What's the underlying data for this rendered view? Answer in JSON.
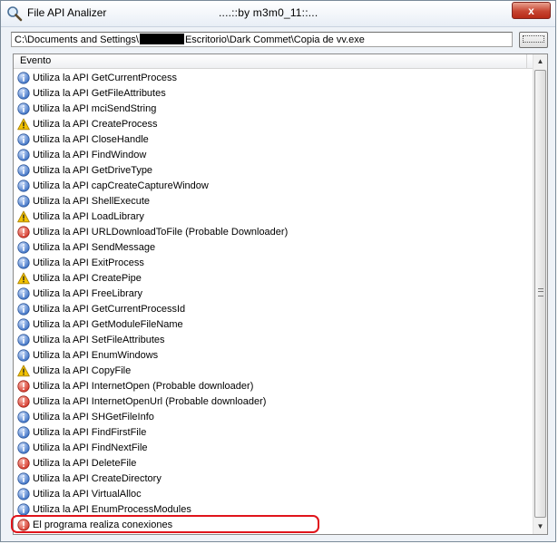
{
  "window": {
    "title": "File API Analizer",
    "title_extra": "....::by m3m0_11::...",
    "close_label": "x"
  },
  "file": {
    "path_before": "C:\\Documents and Settings\\",
    "path_after": "Escritorio\\Dark Commet\\Copia de vv.exe",
    "browse_label": "..."
  },
  "list": {
    "column_header": "Evento",
    "rows": [
      {
        "icon": "info",
        "text": "Utiliza la API GetCurrentProcess"
      },
      {
        "icon": "info",
        "text": "Utiliza la API GetFileAttributes"
      },
      {
        "icon": "info",
        "text": "Utiliza la API mciSendString"
      },
      {
        "icon": "warning",
        "text": "Utiliza la API CreateProcess"
      },
      {
        "icon": "info",
        "text": "Utiliza la API CloseHandle"
      },
      {
        "icon": "info",
        "text": "Utiliza la API FindWindow"
      },
      {
        "icon": "info",
        "text": "Utiliza la API GetDriveType"
      },
      {
        "icon": "info",
        "text": "Utiliza la API capCreateCaptureWindow"
      },
      {
        "icon": "info",
        "text": "Utiliza la API ShellExecute"
      },
      {
        "icon": "warning",
        "text": "Utiliza la API LoadLibrary"
      },
      {
        "icon": "error",
        "text": "Utiliza la API URLDownloadToFile (Probable Downloader)"
      },
      {
        "icon": "info",
        "text": "Utiliza la API SendMessage"
      },
      {
        "icon": "info",
        "text": "Utiliza la API ExitProcess"
      },
      {
        "icon": "warning",
        "text": "Utiliza la API CreatePipe"
      },
      {
        "icon": "info",
        "text": "Utiliza la API FreeLibrary"
      },
      {
        "icon": "info",
        "text": "Utiliza la API GetCurrentProcessId"
      },
      {
        "icon": "info",
        "text": "Utiliza la API GetModuleFileName"
      },
      {
        "icon": "info",
        "text": "Utiliza la API SetFileAttributes"
      },
      {
        "icon": "info",
        "text": "Utiliza la API EnumWindows"
      },
      {
        "icon": "warning",
        "text": "Utiliza la API CopyFile"
      },
      {
        "icon": "error",
        "text": "Utiliza la API InternetOpen (Probable downloader)"
      },
      {
        "icon": "error",
        "text": "Utiliza la API InternetOpenUrl (Probable downloader)"
      },
      {
        "icon": "info",
        "text": "Utiliza la API SHGetFileInfo"
      },
      {
        "icon": "info",
        "text": "Utiliza la API FindFirstFile"
      },
      {
        "icon": "info",
        "text": "Utiliza la API FindNextFile"
      },
      {
        "icon": "error",
        "text": "Utiliza la API DeleteFile"
      },
      {
        "icon": "info",
        "text": "Utiliza la API CreateDirectory"
      },
      {
        "icon": "info",
        "text": "Utiliza la API VirtualAlloc"
      },
      {
        "icon": "info",
        "text": "Utiliza la API EnumProcessModules"
      },
      {
        "icon": "error",
        "text": "El programa realiza conexiones"
      }
    ]
  },
  "colors": {
    "info": "#3a6fc4",
    "warning": "#f2c200",
    "error": "#d6382b",
    "highlight": "#e0141b"
  }
}
